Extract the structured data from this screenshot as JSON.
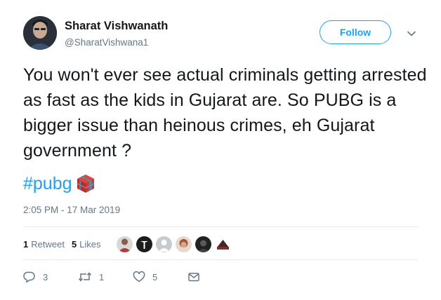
{
  "author": {
    "display_name": "Sharat Vishwanath",
    "handle": "@SharatVishwana1"
  },
  "follow_button_label": "Follow",
  "tweet": {
    "text": "You won't ever see actual criminals getting arrested as fast as the kids in Gujarat are. So PUBG is a bigger issue than heinous crimes, eh Gujarat government ?",
    "hashtag": "#pubg",
    "hashtag_emoji": "airdrop-crate-icon",
    "timestamp": "2:05 PM - 17 Mar 2019"
  },
  "stats": {
    "retweets_count": "1",
    "retweets_label": "Retweet",
    "likes_count": "5",
    "likes_label": "Likes"
  },
  "likers": [
    {
      "name": "liker-avatar-1",
      "color": "#b43a3a"
    },
    {
      "name": "liker-avatar-2",
      "color": "#1c1c1c"
    },
    {
      "name": "liker-avatar-3",
      "color": "#c7ccd1"
    },
    {
      "name": "liker-avatar-4",
      "color": "#9a5a3a"
    },
    {
      "name": "liker-avatar-5",
      "color": "#222222"
    },
    {
      "name": "liker-avatar-6",
      "color": "#3a2a2a"
    }
  ],
  "actions": {
    "reply_count": "3",
    "retweet_count": "1",
    "like_count": "5"
  },
  "colors": {
    "accent": "#1da1f2",
    "secondary_text": "#657786",
    "primary_text": "#14171a",
    "divider": "#e6ecf0"
  },
  "icons": {
    "caret": "chevron-down-icon",
    "reply": "reply-icon",
    "retweet": "retweet-icon",
    "like": "heart-icon",
    "dm": "envelope-icon"
  }
}
